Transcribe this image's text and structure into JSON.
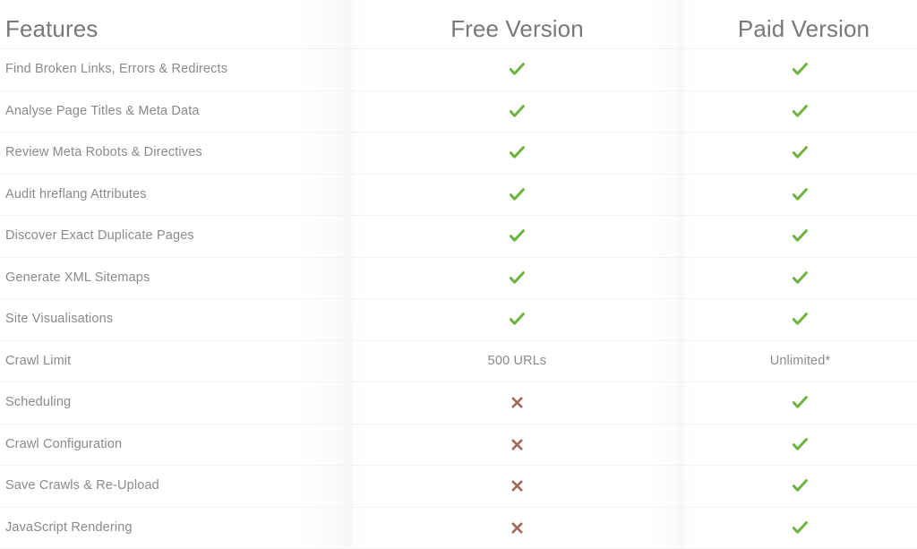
{
  "table": {
    "columns": [
      {
        "key": "feature",
        "label": "Features"
      },
      {
        "key": "free",
        "label": "Free Version"
      },
      {
        "key": "paid",
        "label": "Paid Version"
      }
    ],
    "icons": {
      "yes": "check-icon",
      "no": "cross-icon"
    },
    "colors": {
      "check_green": "#6cb33f",
      "cross_red": "#a3675c",
      "header_text": "#78787a",
      "body_text": "#8a8a8c",
      "row_divider": "#f4f4f4",
      "background": "#ffffff"
    },
    "rows": [
      {
        "feature": "Find Broken Links, Errors & Redirects",
        "free": "yes",
        "paid": "yes"
      },
      {
        "feature": "Analyse Page Titles & Meta Data",
        "free": "yes",
        "paid": "yes"
      },
      {
        "feature": "Review Meta Robots & Directives",
        "free": "yes",
        "paid": "yes"
      },
      {
        "feature": "Audit hreflang Attributes",
        "free": "yes",
        "paid": "yes"
      },
      {
        "feature": "Discover Exact Duplicate Pages",
        "free": "yes",
        "paid": "yes"
      },
      {
        "feature": "Generate XML Sitemaps",
        "free": "yes",
        "paid": "yes"
      },
      {
        "feature": "Site Visualisations",
        "free": "yes",
        "paid": "yes"
      },
      {
        "feature": "Crawl Limit",
        "free": "500 URLs",
        "paid": "Unlimited*"
      },
      {
        "feature": "Scheduling",
        "free": "no",
        "paid": "yes"
      },
      {
        "feature": "Crawl Configuration",
        "free": "no",
        "paid": "yes"
      },
      {
        "feature": "Save Crawls & Re-Upload",
        "free": "no",
        "paid": "yes"
      },
      {
        "feature": "JavaScript Rendering",
        "free": "no",
        "paid": "yes"
      }
    ]
  }
}
